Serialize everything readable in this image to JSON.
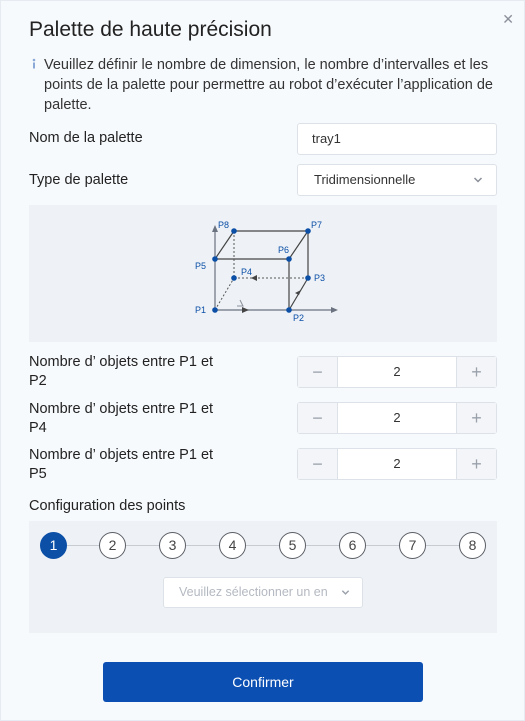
{
  "dialog": {
    "title": "Palette de haute précision",
    "close_icon": "close-icon",
    "info_icon": "info-icon",
    "info_text": "Veuillez définir le nombre de dimension, le nombre d’intervalles et les points de la palette pour permettre au robot d’exécuter l’application de palette."
  },
  "form": {
    "name_label": "Nom de la palette",
    "name_value": "tray1",
    "type_label": "Type de palette",
    "type_value": "Tridimensionnelle",
    "type_chevron_icon": "chevron-down-icon"
  },
  "diagram": {
    "labels": [
      "P8",
      "P7",
      "P6",
      "P5",
      "P4",
      "P3",
      "P1",
      "P2"
    ]
  },
  "counts": [
    {
      "label": "Nombre d’ objets entre P1 et P2",
      "value": "2",
      "minus": "−",
      "plus": "+"
    },
    {
      "label": "Nombre d’ objets entre P1 et P4",
      "value": "2",
      "minus": "−",
      "plus": "+"
    },
    {
      "label": "Nombre d’ objets entre P1 et P5",
      "value": "2",
      "minus": "−",
      "plus": "+"
    }
  ],
  "points": {
    "section_label": "Configuration des points",
    "steps": [
      "1",
      "2",
      "3",
      "4",
      "5",
      "6",
      "7",
      "8"
    ],
    "active_step": "1",
    "select_placeholder": "Veuillez sélectionner un en",
    "select_chevron_icon": "chevron-down-icon"
  },
  "confirm_label": "Confirmer",
  "colors": {
    "accent": "#0b4fb3",
    "point": "#0b4fa7",
    "background": "#f7fafd"
  }
}
